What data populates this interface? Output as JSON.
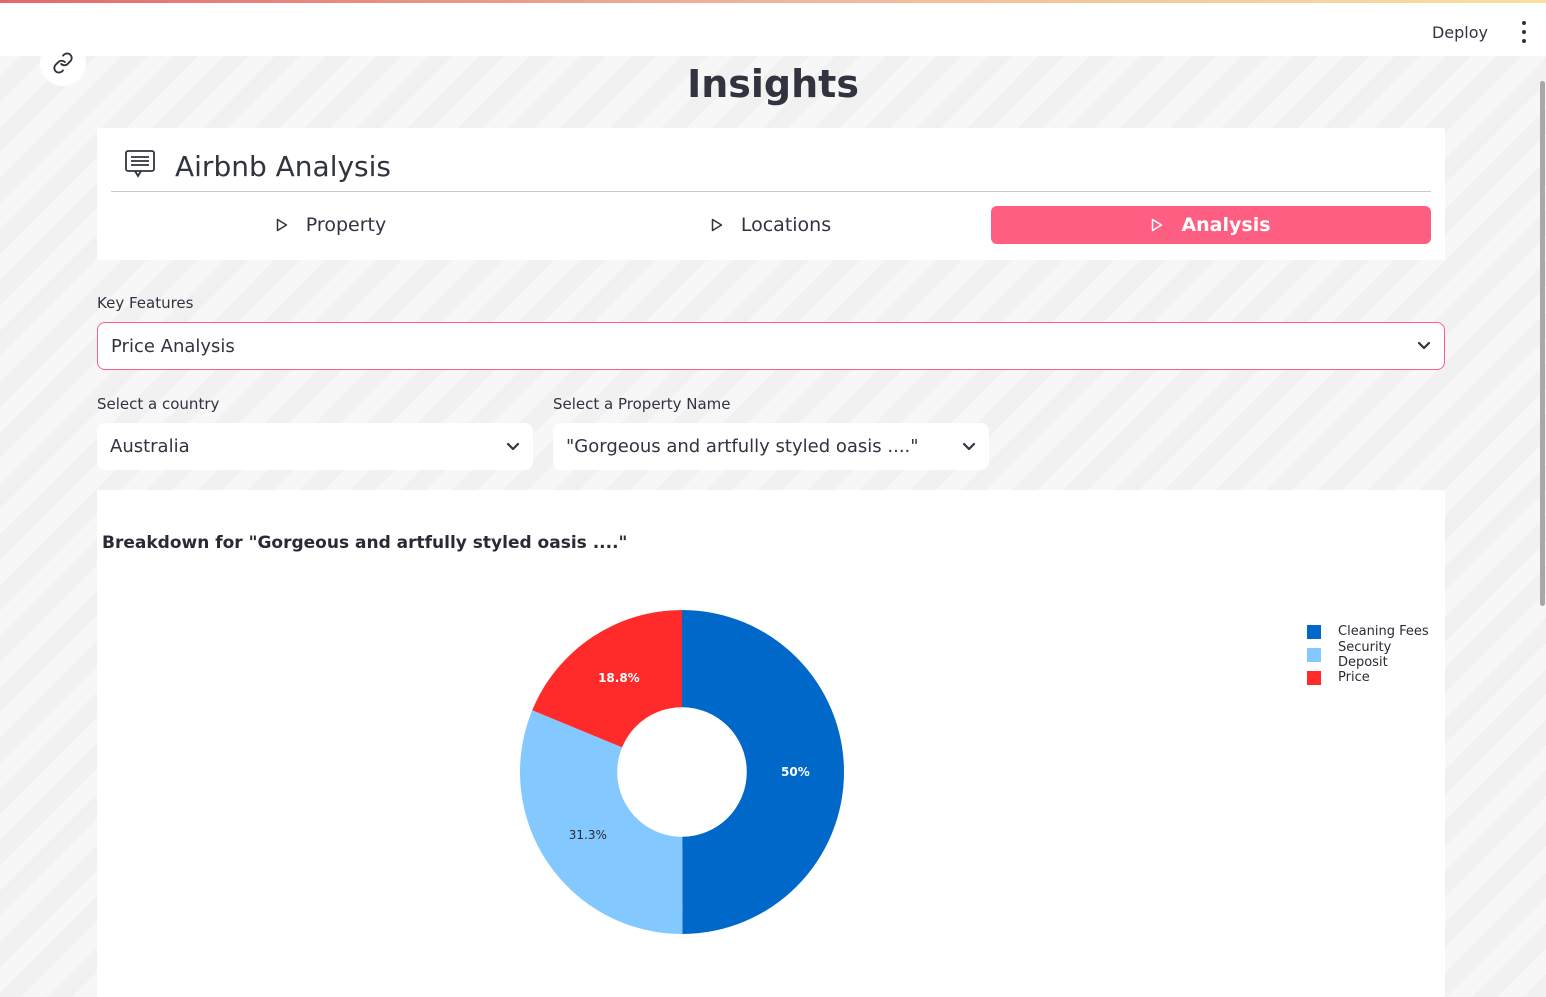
{
  "header": {
    "deploy_label": "Deploy",
    "menu_icon": "kebab-menu-icon"
  },
  "page": {
    "title": "Insights"
  },
  "app": {
    "title": "Airbnb Analysis",
    "icon": "message-card-icon",
    "tabs": [
      {
        "label": "Property",
        "active": false
      },
      {
        "label": "Locations",
        "active": false
      },
      {
        "label": "Analysis",
        "active": true
      }
    ]
  },
  "filters": {
    "key_features": {
      "label": "Key Features",
      "value": "Price Analysis"
    },
    "country": {
      "label": "Select a country",
      "value": "Australia"
    },
    "property": {
      "label": "Select a Property Name",
      "value": "\"Gorgeous and artfully styled oasis ....\""
    }
  },
  "colors": {
    "accent": "#ff5e83",
    "cleaning": "#0068c9",
    "security": "#83c9ff",
    "price": "#ff2b2b"
  },
  "chart_data": {
    "type": "pie",
    "title": "Breakdown for \"Gorgeous and artfully styled oasis ....\"",
    "hole": 0.4,
    "labels": [
      "Cleaning Fees",
      "Security Deposit",
      "Price"
    ],
    "values": [
      50,
      31.3,
      18.8
    ],
    "percent_labels": [
      "50%",
      "31.3%",
      "18.8%"
    ],
    "colors": [
      "#0068c9",
      "#83c9ff",
      "#ff2b2b"
    ],
    "legend_position": "top-right"
  }
}
